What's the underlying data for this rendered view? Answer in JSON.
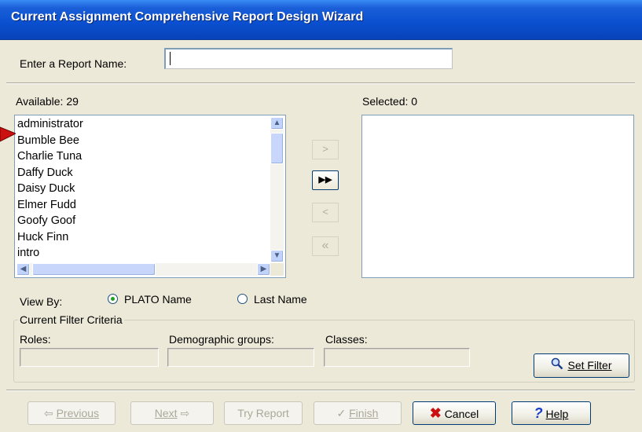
{
  "window": {
    "title": "Current Assignment Comprehensive Report Design Wizard"
  },
  "report_name": {
    "label": "Enter a Report Name:",
    "value": ""
  },
  "available": {
    "label": "Available: 29",
    "items": [
      "administrator",
      "Bumble Bee",
      "Charlie Tuna",
      "Daffy Duck",
      "Daisy Duck",
      "Elmer Fudd",
      "Goofy Goof",
      "Huck Finn",
      "intro"
    ]
  },
  "selected": {
    "label": "Selected: 0",
    "items": []
  },
  "transfer_buttons": {
    "add_one": ">",
    "add_all": "▶▶",
    "remove_one": "<",
    "remove_all": "«"
  },
  "view_by": {
    "label": "View By:",
    "options": [
      {
        "label": "PLATO Name",
        "checked": true
      },
      {
        "label": "Last Name",
        "checked": false
      }
    ]
  },
  "filter": {
    "group_label": "Current Filter Criteria",
    "roles_label": "Roles:",
    "demographic_label": "Demographic groups:",
    "classes_label": "Classes:",
    "set_filter_label": "Set Filter"
  },
  "footer": {
    "previous": "Previous",
    "next": "Next",
    "try_report": "Try Report",
    "finish": "Finish",
    "cancel": "Cancel",
    "help": "Help"
  },
  "colors": {
    "title_bar": "#0a4fcf",
    "window_bg": "#ece9d8",
    "accent_red": "#cc1010"
  }
}
